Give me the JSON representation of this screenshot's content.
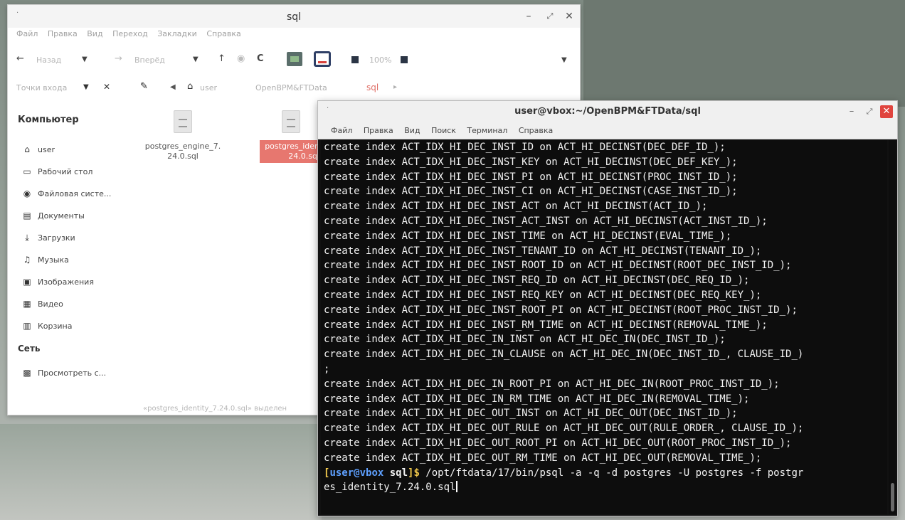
{
  "file_manager": {
    "title": "sql",
    "menu": [
      "Файл",
      "Правка",
      "Вид",
      "Переход",
      "Закладки",
      "Справка"
    ],
    "toolbar": {
      "back_label": "Назад",
      "forward_label": "Вперёд",
      "zoom": "100%"
    },
    "pathbar": {
      "places_label": "Точки входа",
      "crumbs": [
        "user",
        "OpenBPM&FTData",
        "sql"
      ]
    },
    "sidebar": {
      "computer_heading": "Компьютер",
      "computer_items": [
        {
          "icon": "home-icon",
          "label": "user"
        },
        {
          "icon": "desktop-icon",
          "label": "Рабочий стол"
        },
        {
          "icon": "filesystem-icon",
          "label": "Файловая систе..."
        },
        {
          "icon": "documents-icon",
          "label": "Документы"
        },
        {
          "icon": "downloads-icon",
          "label": "Загрузки"
        },
        {
          "icon": "music-icon",
          "label": "Музыка"
        },
        {
          "icon": "pictures-icon",
          "label": "Изображения"
        },
        {
          "icon": "video-icon",
          "label": "Видео"
        },
        {
          "icon": "trash-icon",
          "label": "Корзина"
        }
      ],
      "network_heading": "Сеть",
      "network_items": [
        {
          "icon": "network-icon",
          "label": "Просмотреть с..."
        }
      ]
    },
    "files": [
      {
        "name": "postgres_engine_7.24.0.sql",
        "selected": false
      },
      {
        "name": "postgres_identity_7.24.0.sql",
        "selected": true
      }
    ],
    "files_visible_names": [
      "postgres_engine_7.\n24.0.sql",
      "postgres_iden\n24.0.sql"
    ],
    "status": "«postgres_identity_7.24.0.sql» выделен"
  },
  "terminal": {
    "title": "user@vbox:~/OpenBPM&FTData/sql",
    "menu": [
      "Файл",
      "Правка",
      "Вид",
      "Поиск",
      "Терминал",
      "Справка"
    ],
    "lines": [
      "create index ACT_IDX_HI_DEC_INST_ID on ACT_HI_DECINST(DEC_DEF_ID_);",
      "create index ACT_IDX_HI_DEC_INST_KEY on ACT_HI_DECINST(DEC_DEF_KEY_);",
      "create index ACT_IDX_HI_DEC_INST_PI on ACT_HI_DECINST(PROC_INST_ID_);",
      "create index ACT_IDX_HI_DEC_INST_CI on ACT_HI_DECINST(CASE_INST_ID_);",
      "create index ACT_IDX_HI_DEC_INST_ACT on ACT_HI_DECINST(ACT_ID_);",
      "create index ACT_IDX_HI_DEC_INST_ACT_INST on ACT_HI_DECINST(ACT_INST_ID_);",
      "create index ACT_IDX_HI_DEC_INST_TIME on ACT_HI_DECINST(EVAL_TIME_);",
      "create index ACT_IDX_HI_DEC_INST_TENANT_ID on ACT_HI_DECINST(TENANT_ID_);",
      "create index ACT_IDX_HI_DEC_INST_ROOT_ID on ACT_HI_DECINST(ROOT_DEC_INST_ID_);",
      "create index ACT_IDX_HI_DEC_INST_REQ_ID on ACT_HI_DECINST(DEC_REQ_ID_);",
      "create index ACT_IDX_HI_DEC_INST_REQ_KEY on ACT_HI_DECINST(DEC_REQ_KEY_);",
      "create index ACT_IDX_HI_DEC_INST_ROOT_PI on ACT_HI_DECINST(ROOT_PROC_INST_ID_);",
      "create index ACT_IDX_HI_DEC_INST_RM_TIME on ACT_HI_DECINST(REMOVAL_TIME_);",
      "create index ACT_IDX_HI_DEC_IN_INST on ACT_HI_DEC_IN(DEC_INST_ID_);",
      "create index ACT_IDX_HI_DEC_IN_CLAUSE on ACT_HI_DEC_IN(DEC_INST_ID_, CLAUSE_ID_)",
      ";",
      "create index ACT_IDX_HI_DEC_IN_ROOT_PI on ACT_HI_DEC_IN(ROOT_PROC_INST_ID_);",
      "create index ACT_IDX_HI_DEC_IN_RM_TIME on ACT_HI_DEC_IN(REMOVAL_TIME_);",
      "create index ACT_IDX_HI_DEC_OUT_INST on ACT_HI_DEC_OUT(DEC_INST_ID_);",
      "create index ACT_IDX_HI_DEC_OUT_RULE on ACT_HI_DEC_OUT(RULE_ORDER_, CLAUSE_ID_);",
      "create index ACT_IDX_HI_DEC_OUT_ROOT_PI on ACT_HI_DEC_OUT(ROOT_PROC_INST_ID_);",
      "create index ACT_IDX_HI_DEC_OUT_RM_TIME on ACT_HI_DEC_OUT(REMOVAL_TIME_);"
    ],
    "prompt": {
      "open": "[",
      "user_host": "user@vbox",
      "cwd": " sql",
      "close": "]$",
      "command_line1": " /opt/ftdata/17/bin/psql -a -q -d postgres -U postgres -f postgr",
      "command_line2": "es_identity_7.24.0.sql"
    },
    "colors": {
      "background": "#0d0d0d",
      "text": "#f2f2f2",
      "prompt_user": "#5ea0ff",
      "prompt_bracket": "#f2c94c",
      "close_button": "#e0443e"
    }
  }
}
